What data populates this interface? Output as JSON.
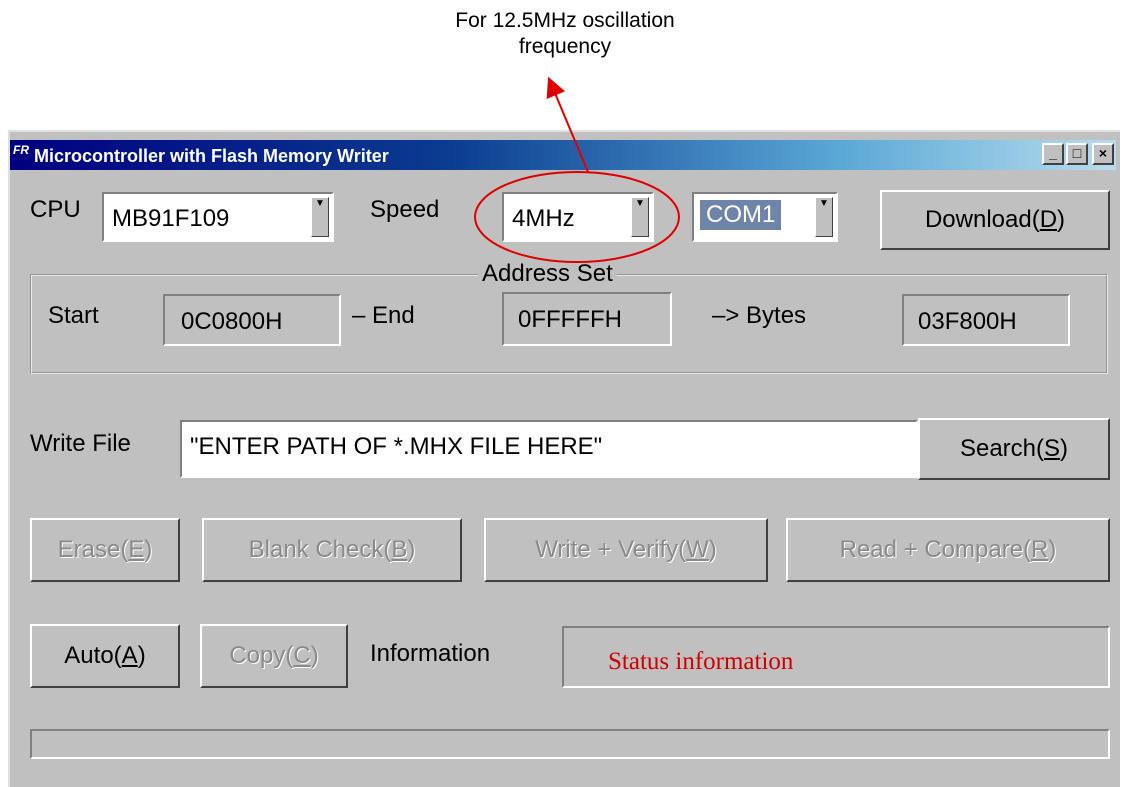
{
  "annotation": {
    "line1": "For 12.5MHz oscillation",
    "line2": "frequency",
    "color": "#e00000"
  },
  "window": {
    "title": "Microcontroller with Flash Memory Writer",
    "icon": "fr-app-icon",
    "controls": {
      "minimize": "_",
      "maximize": "□",
      "close": "×"
    }
  },
  "cpu": {
    "label": "CPU",
    "value": "MB91F109"
  },
  "speed": {
    "label": "Speed",
    "value": "4MHz"
  },
  "port": {
    "value": "COM1"
  },
  "download": {
    "pre": "Download(",
    "key": "D",
    "post": ")"
  },
  "address": {
    "group_label": "Address Set",
    "start_label": "Start",
    "start_value": "0C0800H",
    "end_label": "– End",
    "end_value": "0FFFFFH",
    "bytes_label": "–> Bytes",
    "bytes_value": "03F800H"
  },
  "write_file": {
    "label": "Write File",
    "value": "\"ENTER PATH OF *.MHX FILE HERE\""
  },
  "search": {
    "pre": "Search(",
    "key": "S",
    "post": ")"
  },
  "erase": {
    "pre": "Erase(",
    "key": "E",
    "post": ")"
  },
  "blank_check": {
    "pre": "Blank Check(",
    "key": "B",
    "post": ")"
  },
  "write_verify": {
    "pre": "Write + Verify(",
    "key": "W",
    "post": ")"
  },
  "read_compare": {
    "pre": "Read + Compare(",
    "key": "R",
    "post": ")"
  },
  "auto": {
    "pre": "Auto(",
    "key": "A",
    "post": ")"
  },
  "copy": {
    "pre": "Copy(",
    "key": "C",
    "post": ")"
  },
  "information": {
    "label": "Information",
    "status": "Status information",
    "status_color": "#d00000"
  },
  "progress": {
    "fraction": 0
  }
}
